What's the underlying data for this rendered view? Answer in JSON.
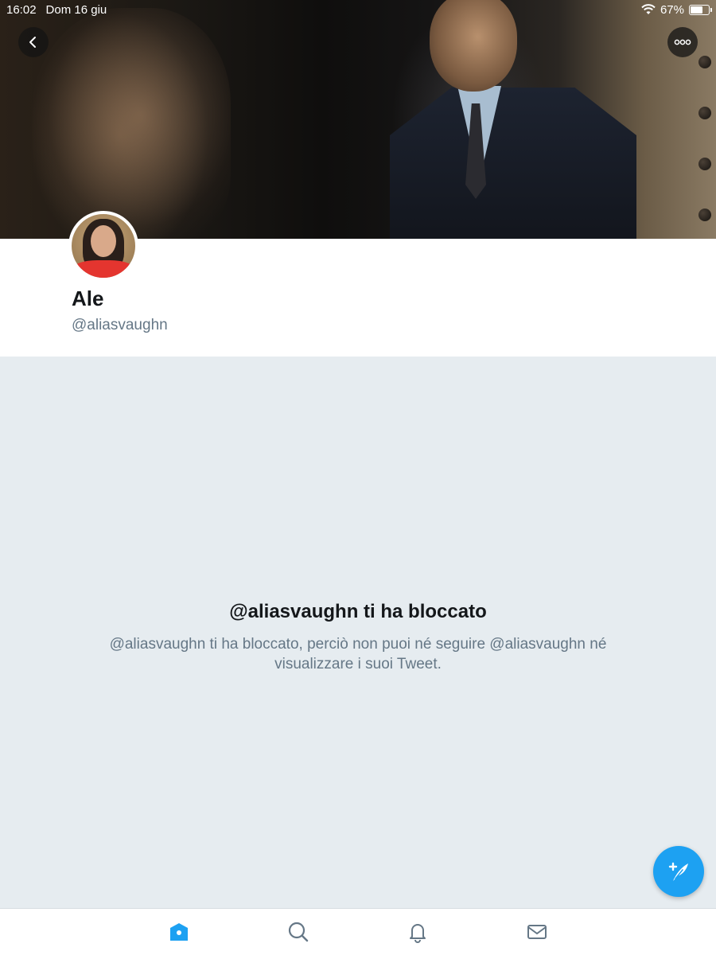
{
  "status_bar": {
    "time": "16:02",
    "date": "Dom 16 giu",
    "battery_text": "67%",
    "battery_level": 0.67
  },
  "icons": {
    "back": "chevron-left-icon",
    "more": "more-icon",
    "compose": "compose-tweet-icon",
    "home": "home-icon",
    "search": "search-icon",
    "notifications": "bell-icon",
    "messages": "mail-icon"
  },
  "profile": {
    "name": "Ale",
    "handle": "@aliasvaughn"
  },
  "blocked": {
    "title": "@aliasvaughn ti ha bloccato",
    "description": "@aliasvaughn ti ha bloccato, perciò non puoi né seguire @aliasvaughn né visualizzare i suoi Tweet."
  },
  "colors": {
    "accent": "#1da1f2",
    "background": "#e6ecf0",
    "secondary_text": "#657786"
  }
}
